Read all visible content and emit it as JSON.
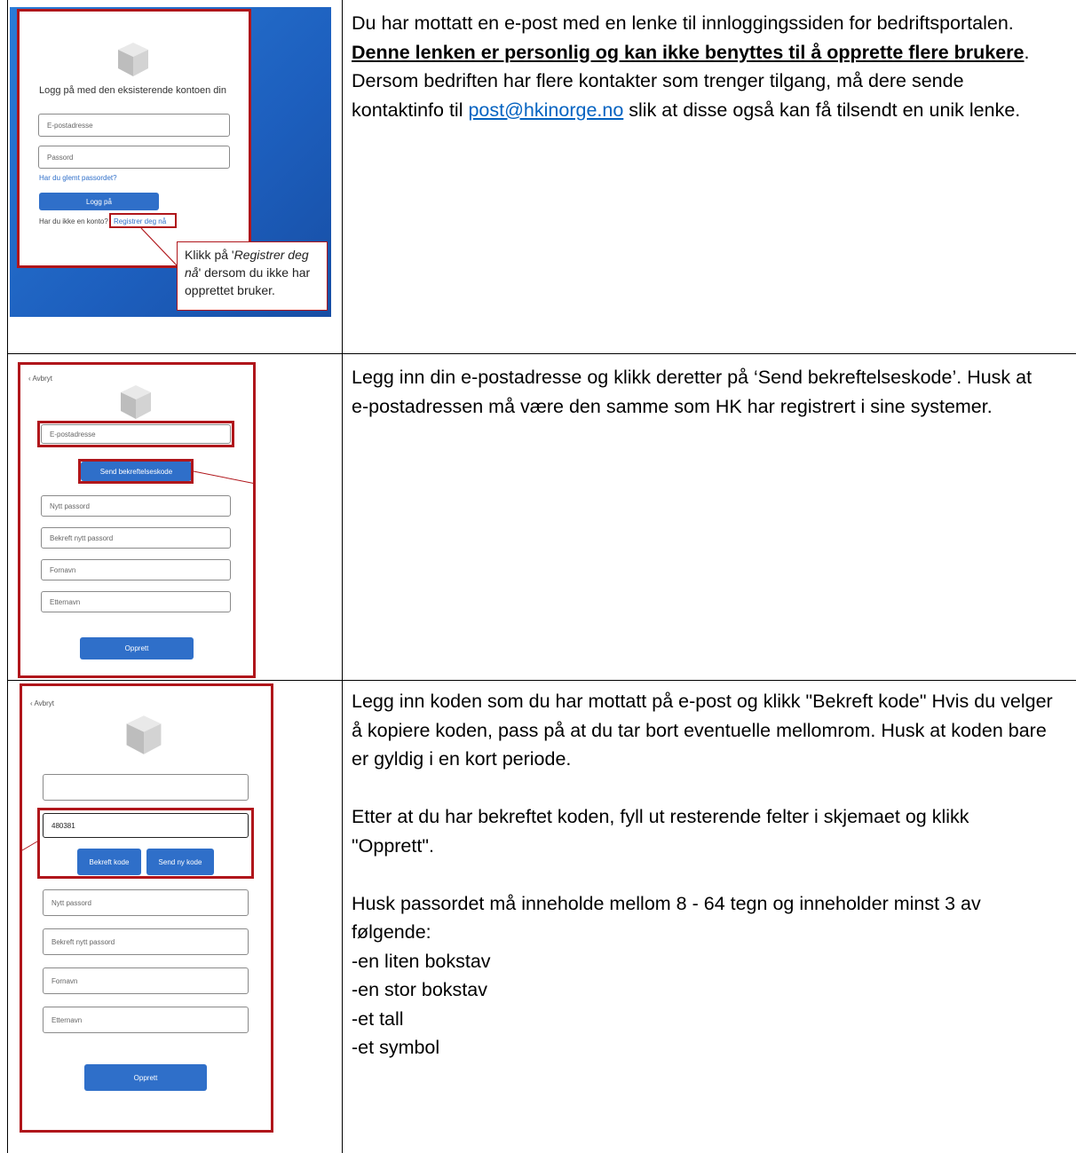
{
  "rows": [
    {
      "login": {
        "heading": "Logg på med den eksisterende kontoen din",
        "email_placeholder": "E-postadresse",
        "password_placeholder": "Passord",
        "forgot": "Har du glemt passordet?",
        "login_button": "Logg på",
        "no_account": "Har du ikke en konto?",
        "register_link": "Registrer deg nå",
        "callout_pre": "Klikk på '",
        "callout_em": "Registrer deg nå",
        "callout_post": "' dersom du ikke har opprettet bruker."
      },
      "text": {
        "p1": "Du har mottatt en e-post med en lenke til innloggingssiden for bedriftsportalen. ",
        "bold": "Denne lenken er personlig og kan ikke benyttes til å opprette flere brukere",
        "p2": ". Dersom bedriften har flere kontakter som trenger tilgang, må dere sende kontaktinfo til ",
        "email_link": "post@hkinorge.no",
        "p3": " slik at disse også kan få tilsendt en unik lenke."
      }
    },
    {
      "form": {
        "back": "Avbryt",
        "email_placeholder": "E-postadresse",
        "send_code_button": "Send bekreftelseskode",
        "new_password": "Nytt passord",
        "confirm_password": "Bekreft nytt passord",
        "first_name": "Fornavn",
        "last_name": "Etternavn",
        "create_button": "Opprett"
      },
      "text": "Legg inn din e-postadresse og klikk deretter på ‘Send bekreftelseskode’. Husk at e-postadressen må være den samme som HK har registrert i sine systemer."
    },
    {
      "form": {
        "back": "Avbryt",
        "code_value": "480381",
        "confirm_code_button": "Bekreft kode",
        "new_code_button": "Send ny kode",
        "new_password": "Nytt passord",
        "confirm_password": "Bekreft nytt passord",
        "first_name": "Fornavn",
        "last_name": "Etternavn",
        "create_button": "Opprett"
      },
      "text": {
        "p1": "Legg inn koden som du har mottatt på e-post og klikk \"Bekreft kode\" Hvis du velger å kopiere koden, pass på at du tar bort eventuelle mellomrom. Husk at koden bare er gyldig i en kort periode.",
        "p2": "Etter at du har bekreftet koden, fyll ut resterende felter i skjemaet og klikk \"Opprett\".",
        "p3": "Husk passordet må inneholde mellom 8 - 64 tegn og inneholder minst 3 av følgende:",
        "list": [
          "-en liten bokstav",
          "-en stor bokstav",
          "-et tall",
          "-et symbol"
        ]
      }
    }
  ],
  "colors": {
    "accent": "#2f6fc9",
    "highlight": "#b0161b",
    "link": "#0563c1",
    "background_blue": "#1f66c2"
  }
}
